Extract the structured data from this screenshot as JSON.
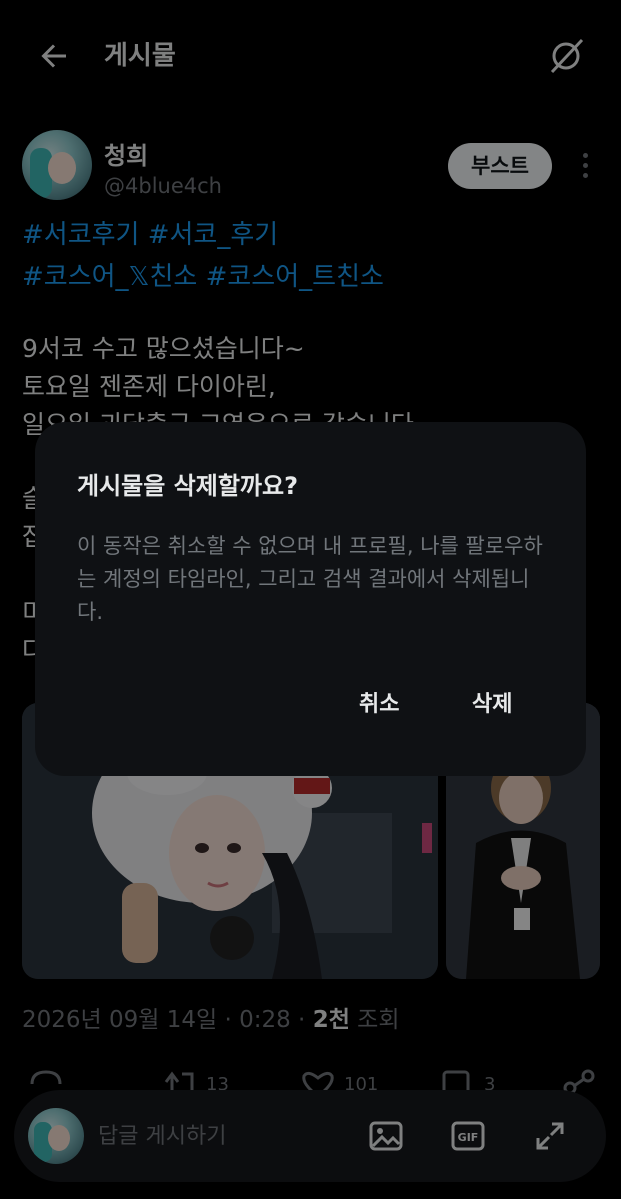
{
  "header": {
    "title": "게시물",
    "back_icon": "arrow-left-icon",
    "grok_icon": "grok-icon"
  },
  "post": {
    "author_name": "청희",
    "author_handle": "@4blue4ch",
    "boost_label": "부스트",
    "tags_line1": "#서코후기 #서코_후기",
    "tags_line2": "#코스어_𝕏친소 #코스어_트친소",
    "body_lines": [
      "9서코 수고 많으셨습니다~",
      "토요일 젠존제 다이아린,",
      "일요일 괴담출근 고영은으로 갔습니다"
    ],
    "partial_lines": [
      "슬",
      "잡",
      "미",
      "다"
    ],
    "timestamp": "2026년 09월 14일 · 0:28 · ",
    "views_count": "2천",
    "views_label": " 조회",
    "stats": {
      "reposts": "13",
      "likes": "101",
      "bookmarks": "3"
    }
  },
  "reply_bar": {
    "placeholder": "답글 게시하기"
  },
  "dialog": {
    "title": "게시물을 삭제할까요?",
    "body": "이 동작은 취소할 수 없으며 내 프로필, 나를 팔로우하는 계정의 타임라인, 그리고 검색 결과에서 삭제됩니다.",
    "cancel_label": "취소",
    "delete_label": "삭제"
  },
  "colors": {
    "accent": "#1d9bf0",
    "background": "#000000",
    "dialog_bg": "#0f1114",
    "muted": "#71767b"
  }
}
